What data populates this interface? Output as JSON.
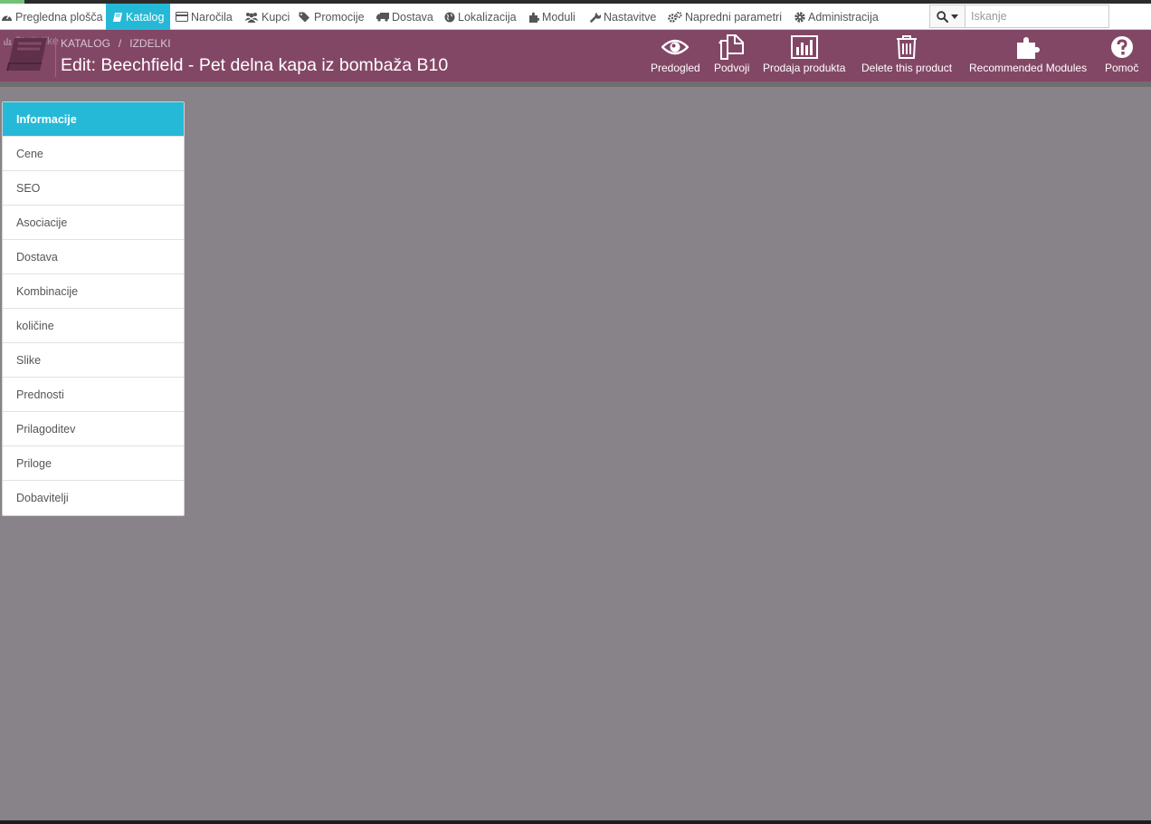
{
  "colors": {
    "accent": "#25b9d7",
    "header": "#834766",
    "overlay": "#888388"
  },
  "topnav": {
    "items": [
      {
        "label": "Pregledna plošča",
        "icon": "dashboard-icon"
      },
      {
        "label": "Katalog",
        "icon": "book-icon"
      },
      {
        "label": "Naročila",
        "icon": "credit-card-icon"
      },
      {
        "label": "Kupci",
        "icon": "users-icon"
      },
      {
        "label": "Promocije",
        "icon": "tag-icon"
      },
      {
        "label": "Dostava",
        "icon": "truck-icon"
      },
      {
        "label": "Lokalizacija",
        "icon": "globe-icon"
      },
      {
        "label": "Moduli",
        "icon": "puzzle-icon"
      },
      {
        "label": "Nastavitve",
        "icon": "wrench-icon"
      },
      {
        "label": "Napredni parametri",
        "icon": "cogs-icon"
      },
      {
        "label": "Administracija",
        "icon": "gear-icon"
      }
    ],
    "active": "Katalog",
    "search": {
      "placeholder": "Iskanje"
    }
  },
  "header": {
    "statistics_label": "Statistike",
    "breadcrumb": [
      "KATALOG",
      "/",
      "IZDELKI"
    ],
    "title": "Edit: Beechfield - Pet delna kapa iz bombaža B10",
    "toolbar": [
      {
        "label": "Predogled",
        "icon": "eye-icon"
      },
      {
        "label": "Podvoji",
        "icon": "copy-icon"
      },
      {
        "label": "Prodaja produkta",
        "icon": "bar-chart-icon"
      },
      {
        "label": "Delete this product",
        "icon": "trash-icon"
      },
      {
        "label": "Recommended Modules",
        "icon": "puzzle-icon"
      },
      {
        "label": "Pomoč",
        "icon": "help-icon"
      }
    ]
  },
  "tabs": {
    "items": [
      "Informacije",
      "Cene",
      "SEO",
      "Asociacije",
      "Dostava",
      "Kombinacije",
      "količine",
      "Slike",
      "Prednosti",
      "Prilagoditev",
      "Priloge",
      "Dobavitelji"
    ],
    "active": "Informacije"
  }
}
